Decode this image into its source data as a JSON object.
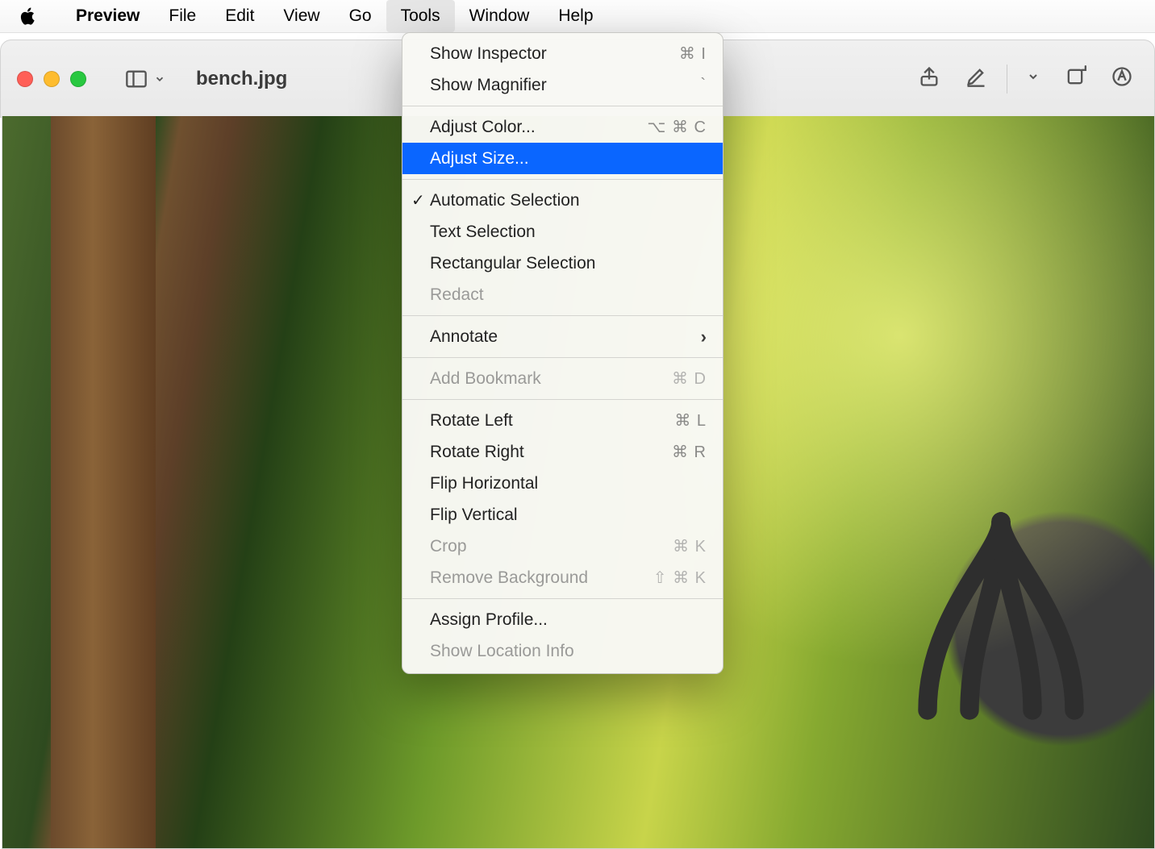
{
  "menubar": {
    "app": "Preview",
    "items": [
      "File",
      "Edit",
      "View",
      "Go",
      "Tools",
      "Window",
      "Help"
    ],
    "open_index": 4
  },
  "window": {
    "title": "bench.jpg"
  },
  "tools_menu": {
    "groups": [
      {
        "items": [
          {
            "label": "Show Inspector",
            "shortcut": "⌘ I",
            "disabled": false
          },
          {
            "label": "Show Magnifier",
            "shortcut": "`",
            "disabled": false
          }
        ]
      },
      {
        "items": [
          {
            "label": "Adjust Color...",
            "shortcut": "⌥ ⌘ C",
            "disabled": false
          },
          {
            "label": "Adjust Size...",
            "shortcut": "",
            "disabled": false,
            "highlight": true
          }
        ]
      },
      {
        "items": [
          {
            "label": "Automatic Selection",
            "shortcut": "",
            "disabled": false,
            "checked": true
          },
          {
            "label": "Text Selection",
            "shortcut": "",
            "disabled": false
          },
          {
            "label": "Rectangular Selection",
            "shortcut": "",
            "disabled": false
          },
          {
            "label": "Redact",
            "shortcut": "",
            "disabled": true
          }
        ]
      },
      {
        "items": [
          {
            "label": "Annotate",
            "shortcut": "",
            "disabled": false,
            "submenu": true
          }
        ]
      },
      {
        "items": [
          {
            "label": "Add Bookmark",
            "shortcut": "⌘ D",
            "disabled": true
          }
        ]
      },
      {
        "items": [
          {
            "label": "Rotate Left",
            "shortcut": "⌘ L",
            "disabled": false
          },
          {
            "label": "Rotate Right",
            "shortcut": "⌘ R",
            "disabled": false
          },
          {
            "label": "Flip Horizontal",
            "shortcut": "",
            "disabled": false
          },
          {
            "label": "Flip Vertical",
            "shortcut": "",
            "disabled": false
          },
          {
            "label": "Crop",
            "shortcut": "⌘ K",
            "disabled": true
          },
          {
            "label": "Remove Background",
            "shortcut": "⇧ ⌘ K",
            "disabled": true
          }
        ]
      },
      {
        "items": [
          {
            "label": "Assign Profile...",
            "shortcut": "",
            "disabled": false
          },
          {
            "label": "Show Location Info",
            "shortcut": "",
            "disabled": true
          }
        ]
      }
    ]
  }
}
